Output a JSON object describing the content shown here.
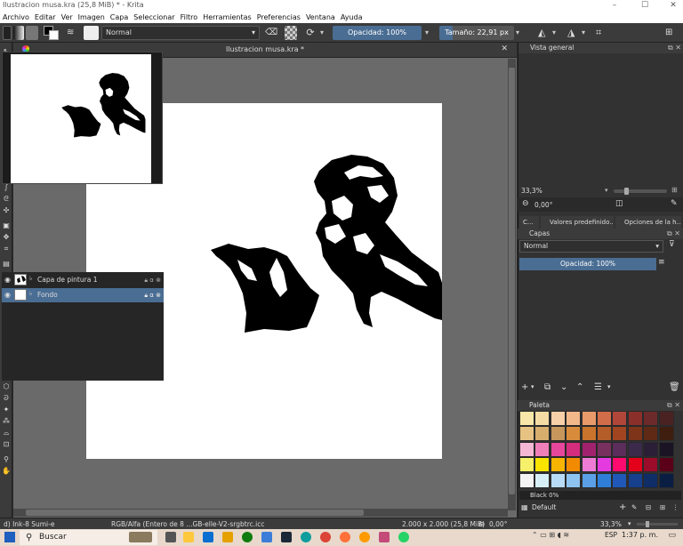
{
  "window": {
    "title": "Ilustracion musa.kra (25,8 MiB)  * - Krita",
    "minimize": "–",
    "maximize": "☐",
    "close": "✕"
  },
  "menu": [
    "Archivo",
    "Editar",
    "Ver",
    "Imagen",
    "Capa",
    "Seleccionar",
    "Filtro",
    "Herramientas",
    "Preferencias",
    "Ventana",
    "Ayuda"
  ],
  "toolbar": {
    "blend_mode": "Normal",
    "opacity": "Opacidad: 100%",
    "size": "Tamaño: 22,91 px"
  },
  "document": {
    "tab_name": "Ilustracion musa.kra *",
    "tab_close": "✕"
  },
  "overview": {
    "title": "Vista general",
    "zoom": "33,3%",
    "rotation": "0,00°"
  },
  "dock_tabs": [
    "C...",
    "Valores predefinido...",
    "Opciones de la h..."
  ],
  "layers": {
    "title": "Capas",
    "blend_mode": "Normal",
    "opacity": "Opacidad:  100%",
    "items": [
      {
        "name": "Capa de pintura 1",
        "active": false
      },
      {
        "name": "Fondo",
        "active": true
      }
    ]
  },
  "palette": {
    "title": "Paleta",
    "selected_color": "Black 0%",
    "palette_name": "Default",
    "colors": [
      "#f8e7a8",
      "#f5dca5",
      "#f7cfa8",
      "#f2b88a",
      "#e89a6a",
      "#d26d4a",
      "#b0463a",
      "#8b2f2a",
      "#6c2a2a",
      "#4a2222",
      "#e6c383",
      "#d7ae6d",
      "#c6965c",
      "#d98b3c",
      "#c9742d",
      "#b55d28",
      "#a04520",
      "#7e3418",
      "#5e2a15",
      "#3f1e10",
      "#f5b8d4",
      "#ef7fb8",
      "#e6479a",
      "#d42d7d",
      "#a0226d",
      "#78305f",
      "#5a2d5a",
      "#3c2a4a",
      "#2a1f36",
      "#1a1424",
      "#f7f06a",
      "#f9e400",
      "#f7b400",
      "#f28b00",
      "#ee7cd4",
      "#e53ae0",
      "#ff0a6e",
      "#e3001b",
      "#9b0b2a",
      "#5a0018",
      "#f4f4f4",
      "#d7f0f7",
      "#b8dcf6",
      "#8ec3f0",
      "#5ba0e6",
      "#2f7ed8",
      "#1f58b7",
      "#163f8c",
      "#0f2d66",
      "#0a1e44"
    ]
  },
  "status": {
    "brush": "d) Ink-8 Sumi-e",
    "color_space": "RGB/Alfa (Entero de 8 ...GB-elle-V2-srgbtrc.icc",
    "dimensions": "2.000 x 2.000 (25,8 MiB)",
    "rotation": "0,00°",
    "zoom": "33,3%"
  },
  "taskbar": {
    "search_placeholder": "Buscar",
    "language": "ESP",
    "time": "1:37 p. m."
  }
}
